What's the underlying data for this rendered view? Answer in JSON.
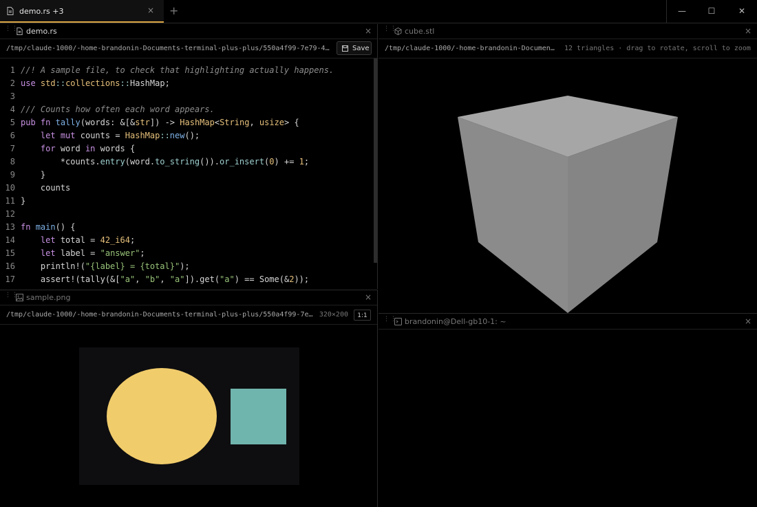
{
  "tab": {
    "label": "demo.rs +3",
    "close": "×"
  },
  "new_tab": "+",
  "window": {
    "minimize": "—",
    "maximize": "☐",
    "close": "✕"
  },
  "editor": {
    "title": "demo.rs",
    "path": "/tmp/claude-1000/-home-brandonin-Documents-terminal-plus-plus/550a4f99-7e79-4…",
    "save_label": "Save",
    "lines": [
      "1",
      "2",
      "3",
      "4",
      "5",
      "6",
      "7",
      "8",
      "9",
      "10",
      "11",
      "12",
      "13",
      "14",
      "15",
      "16",
      "17"
    ]
  },
  "image_pane": {
    "title": "sample.png",
    "path": "/tmp/claude-1000/-home-brandonin-Documents-terminal-plus-plus/550a4f99-7e…",
    "size": "320×200",
    "zoom": "1:1"
  },
  "model_pane": {
    "title": "cube.stl",
    "path": "/tmp/claude-1000/-home-brandonin-Document…",
    "hint": "12 triangles · drag to rotate, scroll to zoom"
  },
  "terminal_pane": {
    "title": "brandonin@Dell-gb10-1: ~"
  },
  "colors": {
    "accent": "#d9a441",
    "ellipse": "#f1cc6b",
    "square": "#70b4ae"
  },
  "icons": [
    "file-icon",
    "image-icon",
    "cube-icon",
    "terminal-icon",
    "save-icon",
    "grip-icon"
  ]
}
